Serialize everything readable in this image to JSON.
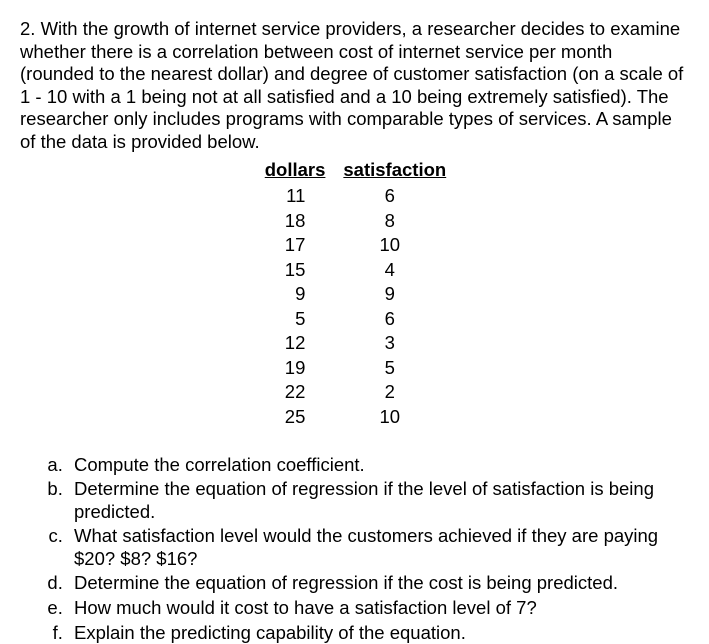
{
  "problem_number": "2.",
  "intro": "With the growth of internet service providers, a researcher decides to examine whether there is a correlation between cost of internet service per month (rounded to the nearest dollar) and degree of customer satisfaction (on a scale of 1 - 10 with a 1 being not at all satisfied and a 10 being extremely satisfied). The researcher only includes programs with comparable types of services. A sample of the data is provided below.",
  "chart_data": {
    "type": "table",
    "headers": [
      "dollars",
      "satisfaction"
    ],
    "rows": [
      {
        "dollars": 11,
        "satisfaction": 6
      },
      {
        "dollars": 18,
        "satisfaction": 8
      },
      {
        "dollars": 17,
        "satisfaction": 10
      },
      {
        "dollars": 15,
        "satisfaction": 4
      },
      {
        "dollars": 9,
        "satisfaction": 9
      },
      {
        "dollars": 5,
        "satisfaction": 6
      },
      {
        "dollars": 12,
        "satisfaction": 3
      },
      {
        "dollars": 19,
        "satisfaction": 5
      },
      {
        "dollars": 22,
        "satisfaction": 2
      },
      {
        "dollars": 25,
        "satisfaction": 10
      }
    ]
  },
  "questions": {
    "a": "Compute the correlation coefficient.",
    "b": "Determine the equation of regression if the level of satisfaction is being predicted.",
    "c": "What satisfaction level would the customers achieved if they are paying $20? $8? $16?",
    "d": "Determine the equation of regression if the cost is being predicted.",
    "e": "How much would it cost to have a satisfaction level of 7?",
    "f": "Explain the predicting capability of the equation."
  }
}
